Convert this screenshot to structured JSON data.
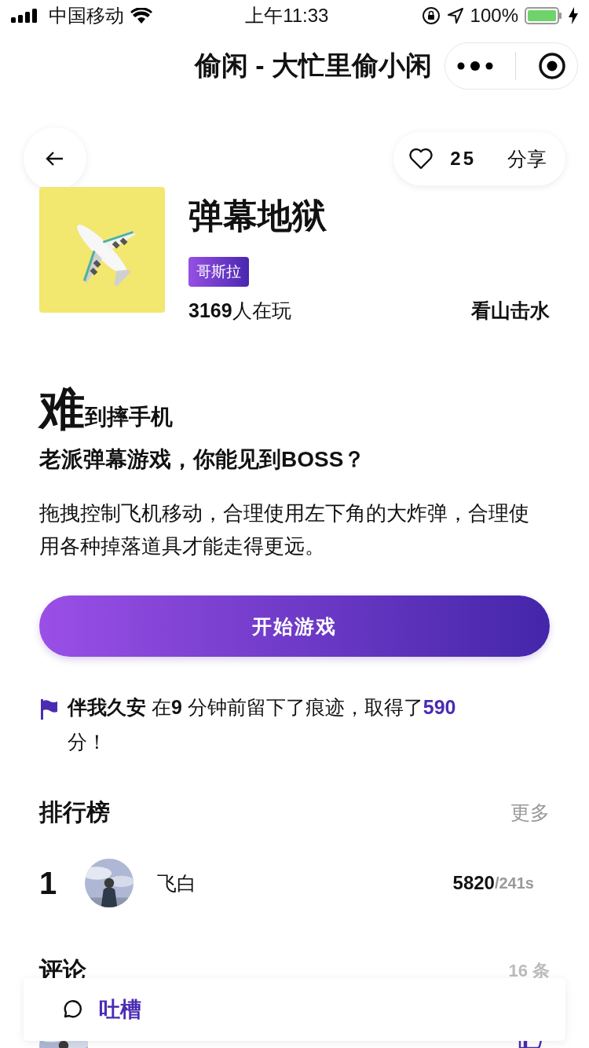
{
  "status_bar": {
    "carrier": "中国移动",
    "time": "上午11:33",
    "battery": "100%"
  },
  "nav_bar": {
    "title": "偷闲 - 大忙里偷小闲"
  },
  "actions": {
    "likes": "25",
    "share": "分享"
  },
  "game": {
    "title": "弹幕地狱",
    "tag": "哥斯拉",
    "players_count": "3169",
    "players_label": "人在玩",
    "author": "看山击水"
  },
  "headline": {
    "big": "难",
    "rest": "到摔手机"
  },
  "subtitle": "老派弹幕游戏，你能见到**BOSS**？",
  "description": "拖拽控制飞机移动，合理使用左下角的大炸弹，合理使用各种掉落道具才能走得更远。",
  "start_button": "开始游戏",
  "trace": "**伴我久安** 在**9** 分钟前留下了痕迹，取得了**590**分！",
  "leaderboard": {
    "title": "排行榜",
    "more": "更多",
    "rows": [
      {
        "rank": "1",
        "name": "飞白",
        "score": "5820",
        "time": "/241s"
      }
    ]
  },
  "comments": {
    "title": "评论",
    "count": "16 条"
  },
  "comment_bar": {
    "label": "吐槽"
  }
}
